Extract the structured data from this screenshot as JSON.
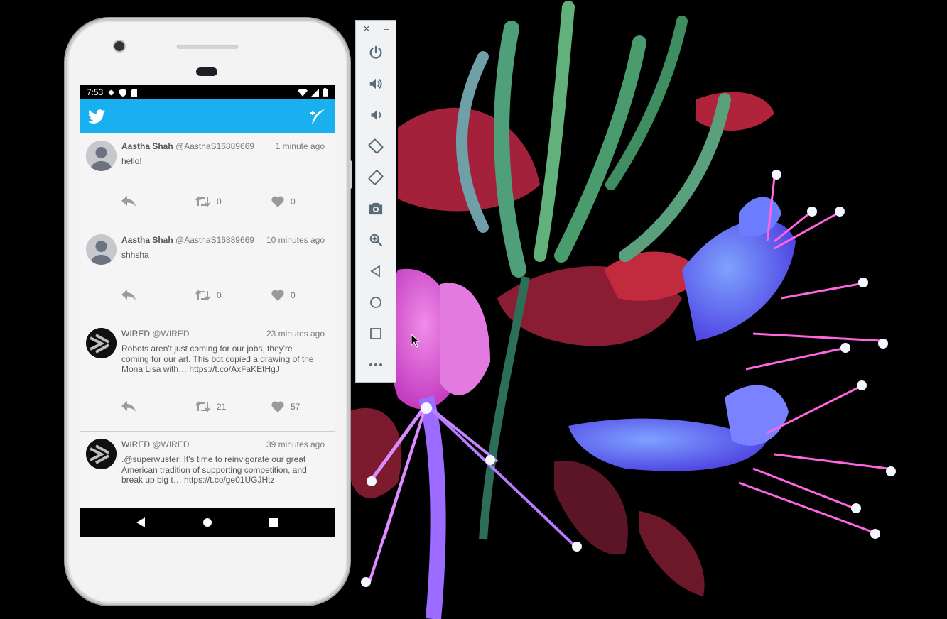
{
  "status_bar": {
    "time": "7:53"
  },
  "app": {
    "brand_color": "#1ab0f0"
  },
  "tweets": [
    {
      "author": "Aastha Shah",
      "handle": "@AasthaS16889669",
      "time": "1 minute ago",
      "text": "hello!",
      "avatar": "default-avatar",
      "retweets": "0",
      "likes": "0"
    },
    {
      "author": "Aastha Shah",
      "handle": "@AasthaS16889669",
      "time": "10 minutes ago",
      "text": "shhsha",
      "avatar": "default-avatar",
      "retweets": "0",
      "likes": "0"
    },
    {
      "author": "WIRED",
      "handle": "@WIRED",
      "time": "23 minutes ago",
      "text": "Robots aren't just coming for our jobs, they're coming for our art. This bot copied a drawing of the Mona Lisa with… https://t.co/AxFaKEtHgJ",
      "avatar": "wired-logo",
      "retweets": "21",
      "likes": "57"
    },
    {
      "author": "WIRED",
      "handle": "@WIRED",
      "time": "39 minutes ago",
      "text": ".@superwuster: It's time to reinvigorate our great American tradition of supporting competition, and break up big t… https://t.co/ge01UGJHtz",
      "avatar": "wired-logo"
    }
  ],
  "emulator_toolbar": {
    "window_controls": [
      "close-icon",
      "minimize-icon"
    ],
    "tools": [
      "power-icon",
      "volume-up-icon",
      "volume-down-icon",
      "rotate-left-icon",
      "rotate-right-icon",
      "camera-icon",
      "zoom-icon",
      "back-icon",
      "home-icon",
      "overview-icon",
      "more-icon"
    ]
  }
}
